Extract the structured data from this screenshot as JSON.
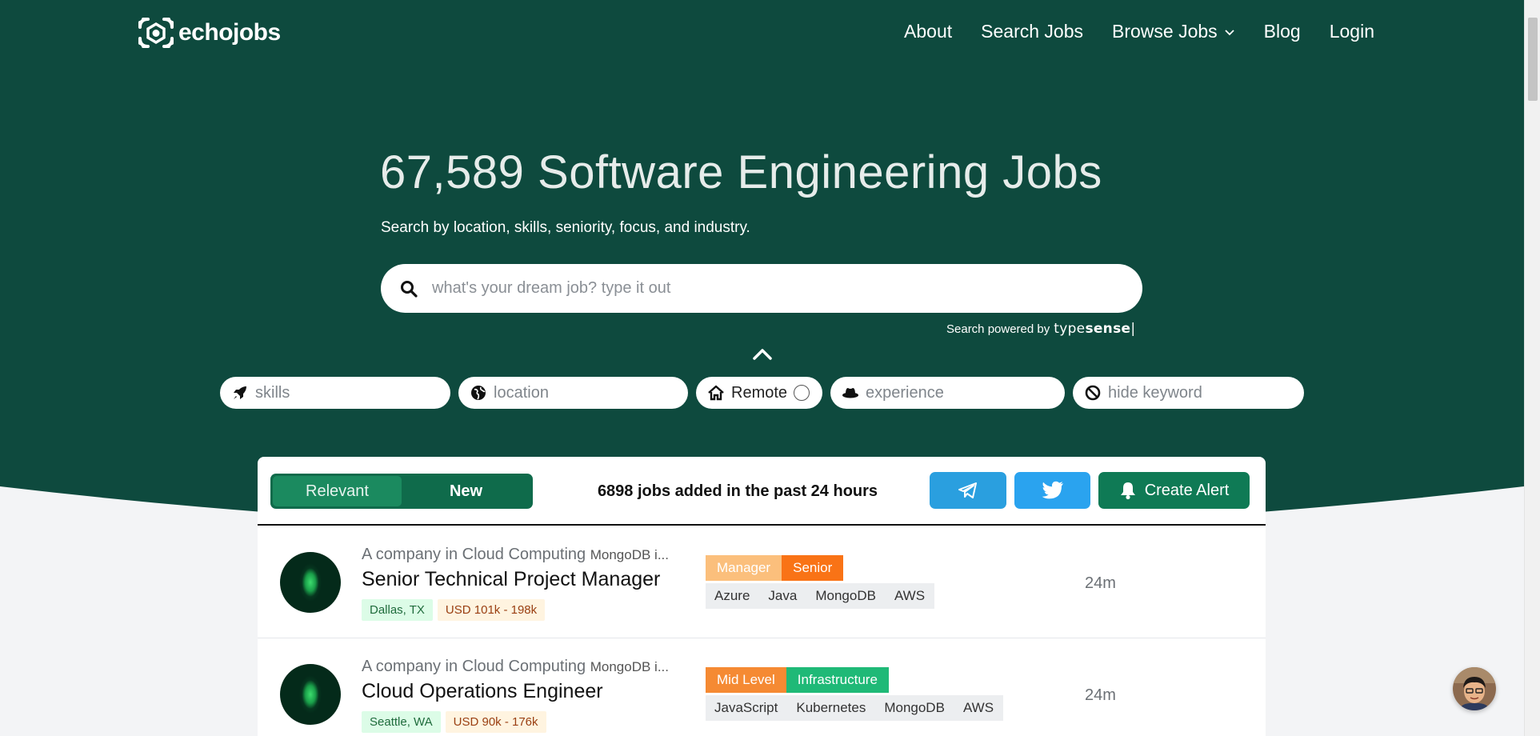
{
  "nav": {
    "brand": "echojobs",
    "links": [
      "About",
      "Search Jobs",
      "Browse Jobs",
      "Blog",
      "Login"
    ]
  },
  "hero": {
    "title": "67,589 Software Engineering Jobs",
    "subtitle": "Search by location, skills, seniority, focus, and industry.",
    "search_placeholder": "what's your dream job? type it out",
    "powered_by": "Search powered by",
    "powered_brand_a": "type",
    "powered_brand_b": "sense"
  },
  "filters": {
    "skills_placeholder": "skills",
    "location_placeholder": "location",
    "remote_label": "Remote",
    "experience_placeholder": "experience",
    "hide_placeholder": "hide keyword"
  },
  "toolbar": {
    "tab_relevant": "Relevant",
    "tab_new": "New",
    "added_text": "6898 jobs added in the past 24 hours",
    "alert_label": "Create Alert"
  },
  "jobs": [
    {
      "company": "A company in Cloud Computing",
      "company_tag": "MongoDB i...",
      "title": "Senior Technical Project Manager",
      "location": "Dallas, TX",
      "salary": "USD 101k  -  198k",
      "badges": [
        {
          "label": "Manager",
          "color": "#fbbf7c"
        },
        {
          "label": "Senior",
          "color": "#f97316"
        }
      ],
      "skills": [
        "Azure",
        "Java",
        "MongoDB",
        "AWS"
      ],
      "age": "24m"
    },
    {
      "company": "A company in Cloud Computing",
      "company_tag": "MongoDB i...",
      "title": "Cloud Operations Engineer",
      "location": "Seattle, WA",
      "salary": "USD 90k  -  176k",
      "badges": [
        {
          "label": "Mid Level",
          "color": "#f58a33"
        },
        {
          "label": "Infrastructure",
          "color": "#1fb977"
        }
      ],
      "skills": [
        "JavaScript",
        "Kubernetes",
        "MongoDB",
        "AWS"
      ],
      "age": "24m"
    }
  ],
  "colors": {
    "hero_bg": "#0e4a3e",
    "accent": "#0f7a55",
    "telegram": "#2a9fdf",
    "twitter": "#2aa3ef"
  }
}
